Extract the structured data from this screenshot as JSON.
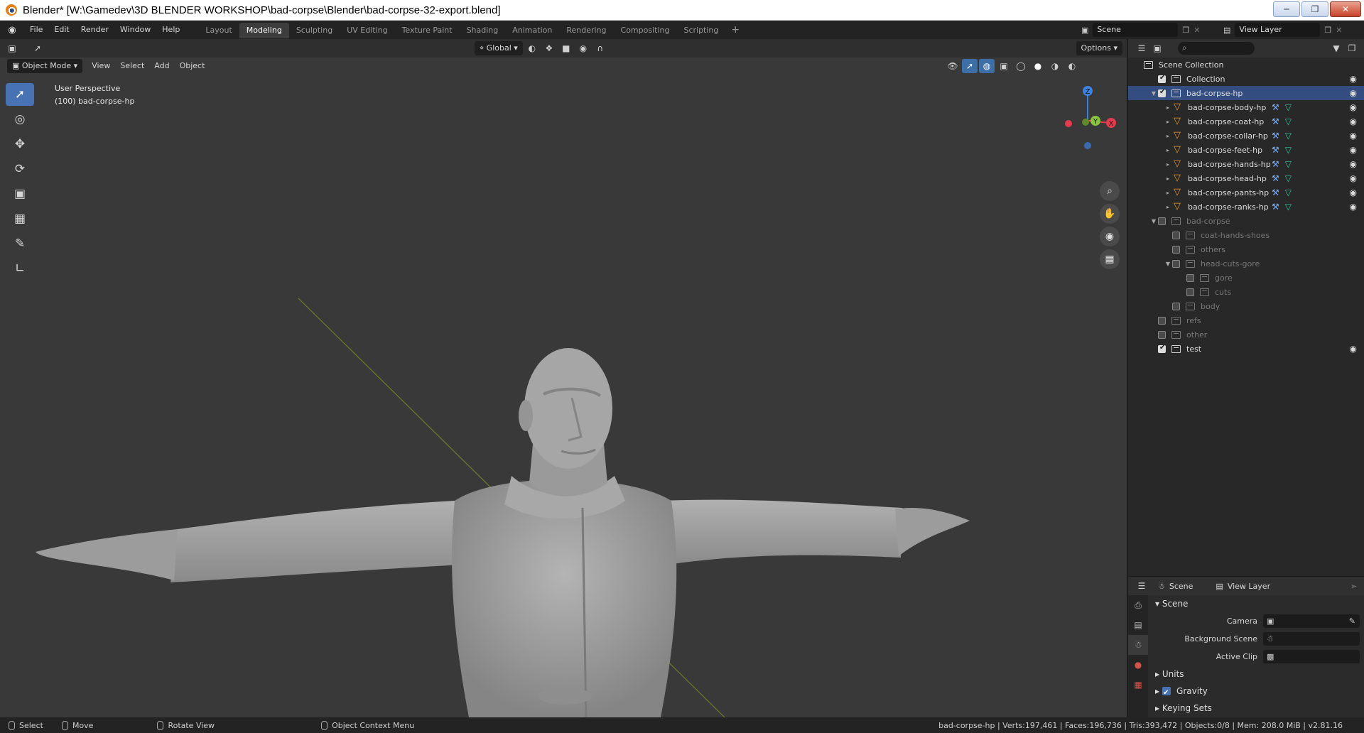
{
  "window": {
    "title": "Blender* [W:\\Gamedev\\3D BLENDER WORKSHOP\\bad-corpse\\Blender\\bad-corpse-32-export.blend]"
  },
  "menu": {
    "file": "File",
    "edit": "Edit",
    "render": "Render",
    "window": "Window",
    "help": "Help"
  },
  "workspaces": [
    {
      "label": "Layout"
    },
    {
      "label": "Modeling",
      "active": true
    },
    {
      "label": "Sculpting"
    },
    {
      "label": "UV Editing"
    },
    {
      "label": "Texture Paint"
    },
    {
      "label": "Shading"
    },
    {
      "label": "Animation"
    },
    {
      "label": "Rendering"
    },
    {
      "label": "Compositing"
    },
    {
      "label": "Scripting"
    }
  ],
  "workspace_add": "+",
  "scene": {
    "name": "Scene",
    "view_layer": "View Layer"
  },
  "viewport": {
    "transform_orientation": "Global",
    "options_label": "Options",
    "mode": "Object Mode",
    "view_menu": "View",
    "select_menu": "Select",
    "add_menu": "Add",
    "object_menu": "Object",
    "perspective": "User Perspective",
    "active_object": "(100) bad-corpse-hp",
    "gizmo": {
      "z": "Z",
      "y": "Y",
      "x": "X",
      "x_color": "#e8394e",
      "y_color": "#86c53c",
      "z_color": "#3a83e0"
    }
  },
  "outliner": {
    "rows": [
      {
        "label": "Scene Collection",
        "type": "scene"
      },
      {
        "label": "Collection",
        "type": "collection",
        "checked": true,
        "visible": true
      },
      {
        "label": "bad-corpse-hp",
        "type": "collection",
        "checked": true,
        "visible": true,
        "selected": true,
        "expanded": true
      },
      {
        "label": "bad-corpse-body-hp",
        "type": "mesh",
        "visible": true
      },
      {
        "label": "bad-corpse-coat-hp",
        "type": "mesh",
        "visible": true
      },
      {
        "label": "bad-corpse-collar-hp",
        "type": "mesh",
        "visible": true
      },
      {
        "label": "bad-corpse-feet-hp",
        "type": "mesh",
        "visible": true
      },
      {
        "label": "bad-corpse-hands-hp",
        "type": "mesh",
        "visible": true
      },
      {
        "label": "bad-corpse-head-hp",
        "type": "mesh",
        "visible": true
      },
      {
        "label": "bad-corpse-pants-hp",
        "type": "mesh",
        "visible": true
      },
      {
        "label": "bad-corpse-ranks-hp",
        "type": "mesh",
        "visible": true
      },
      {
        "label": "bad-corpse",
        "type": "collection",
        "dim": true,
        "expanded": true
      },
      {
        "label": "coat-hands-shoes",
        "type": "collection",
        "dim": true
      },
      {
        "label": "others",
        "type": "collection",
        "dim": true
      },
      {
        "label": "head-cuts-gore",
        "type": "collection",
        "dim": true,
        "expanded": true
      },
      {
        "label": "gore",
        "type": "collection",
        "dim": true
      },
      {
        "label": "cuts",
        "type": "collection",
        "dim": true
      },
      {
        "label": "body",
        "type": "collection",
        "dim": true
      },
      {
        "label": "refs",
        "type": "collection",
        "dim": true
      },
      {
        "label": "other",
        "type": "collection",
        "dim": true
      },
      {
        "label": "test",
        "type": "collection",
        "checked": true,
        "visible": true
      }
    ]
  },
  "properties": {
    "tab_scene": "Scene",
    "tab_view_layer": "View Layer",
    "panel_scene": "Scene",
    "camera_label": "Camera",
    "background_scene_label": "Background Scene",
    "active_clip_label": "Active Clip",
    "units": "Units",
    "gravity": "Gravity",
    "keying_sets": "Keying Sets"
  },
  "statusbar": {
    "select": "Select",
    "move": "Move",
    "rotate_view": "Rotate View",
    "context_menu": "Object Context Menu",
    "stats": "bad-corpse-hp | Verts:197,461 | Faces:196,736 | Tris:393,472 | Objects:0/8 | Mem: 208.0 MiB | v2.81.16"
  }
}
